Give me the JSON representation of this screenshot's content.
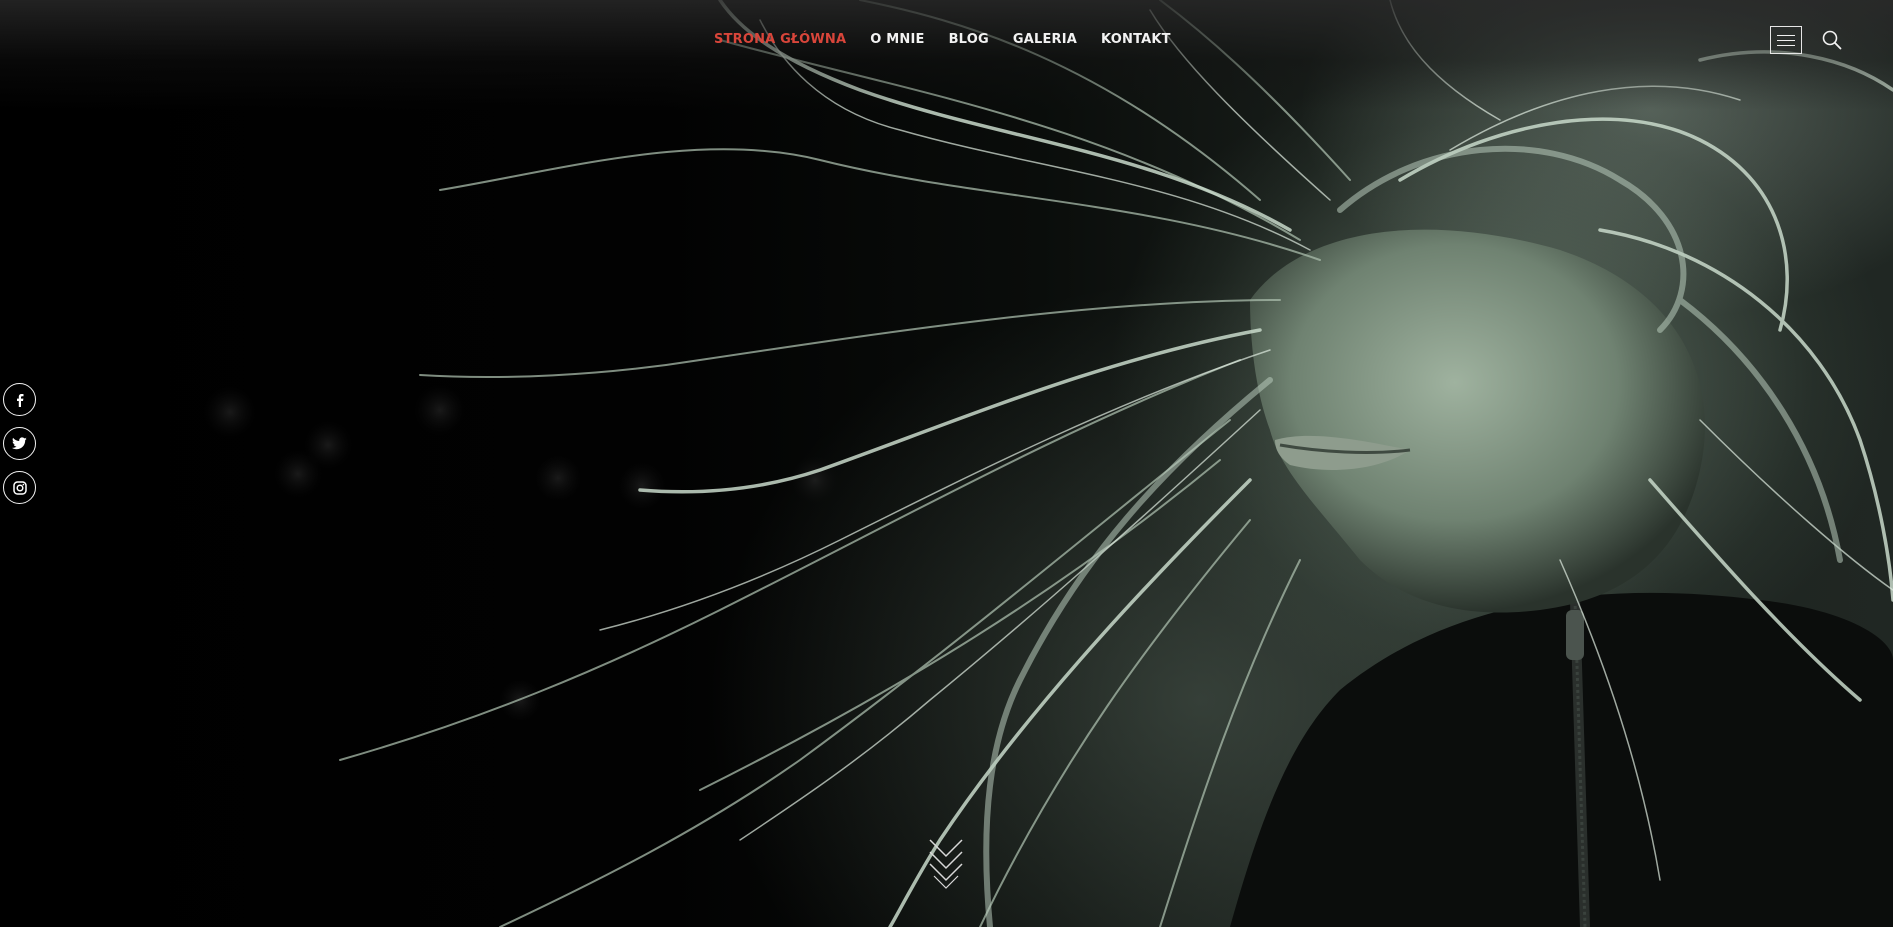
{
  "nav": {
    "items": [
      {
        "label": "STRONA GŁÓWNA",
        "active": true
      },
      {
        "label": "O MNIE",
        "active": false
      },
      {
        "label": "BLOG",
        "active": false
      },
      {
        "label": "GALERIA",
        "active": false
      },
      {
        "label": "KONTAKT",
        "active": false
      }
    ]
  },
  "header": {
    "menu_icon": "hamburger-icon",
    "search_icon": "search-icon"
  },
  "social": {
    "items": [
      {
        "icon": "facebook-icon"
      },
      {
        "icon": "twitter-icon"
      },
      {
        "icon": "instagram-icon"
      }
    ]
  },
  "hero": {
    "image": "woman with windswept light hair on dark background",
    "scroll_icon": "chevrons-down-icon"
  },
  "colors": {
    "accent": "#d9453a",
    "nav_text": "#f2f2f2",
    "background": "#000000",
    "hair_tint": "#b9ccbd"
  }
}
